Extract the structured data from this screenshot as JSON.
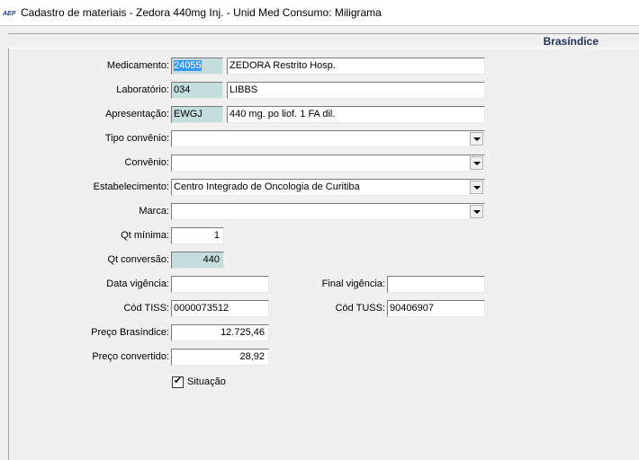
{
  "window": {
    "title": "Cadastro de materiais  -  Zedora 440mg Inj.  -  Unid Med Consumo: Miligrama",
    "icon": "app-icon"
  },
  "section": {
    "title": "Brasíndice"
  },
  "form": {
    "medicamento": {
      "label": "Medicamento:",
      "code": "24055",
      "name": "ZEDORA Restrito Hosp."
    },
    "laboratorio": {
      "label": "Laboratório:",
      "code": "034",
      "name": "LIBBS"
    },
    "apresentacao": {
      "label": "Apresentação:",
      "code": "EWGJ",
      "name": "440 mg. po liof. 1 FA dil."
    },
    "tipo_convenio": {
      "label": "Tipo convênio:",
      "value": ""
    },
    "convenio": {
      "label": "Convênio:",
      "value": ""
    },
    "estabelecimento": {
      "label": "Estabelecimento:",
      "value": "Centro Integrado de Oncologia de Curitiba"
    },
    "marca": {
      "label": "Marca:",
      "value": ""
    },
    "qt_minima": {
      "label": "Qt mínima:",
      "value": "1"
    },
    "qt_conversao": {
      "label": "Qt conversão:",
      "value": "440"
    },
    "data_vigencia": {
      "label": "Data vigência:",
      "value": ""
    },
    "final_vigencia": {
      "label": "Final vigência:",
      "value": ""
    },
    "cod_tiss": {
      "label": "Cód TISS:",
      "value": "0000073512"
    },
    "cod_tuss": {
      "label": "Cód TUSS:",
      "value": "90406907"
    },
    "preco_brasindice": {
      "label": "Preço Brasíndice:",
      "value": "12.725,46"
    },
    "preco_convertido": {
      "label": "Preço convertido:",
      "value": "28,92"
    },
    "situacao": {
      "label": "Situação",
      "checked": true
    }
  },
  "colors": {
    "readonly_bg": "#c3dedd",
    "selection": "#3399ff",
    "section_title": "#1c2f5a"
  }
}
